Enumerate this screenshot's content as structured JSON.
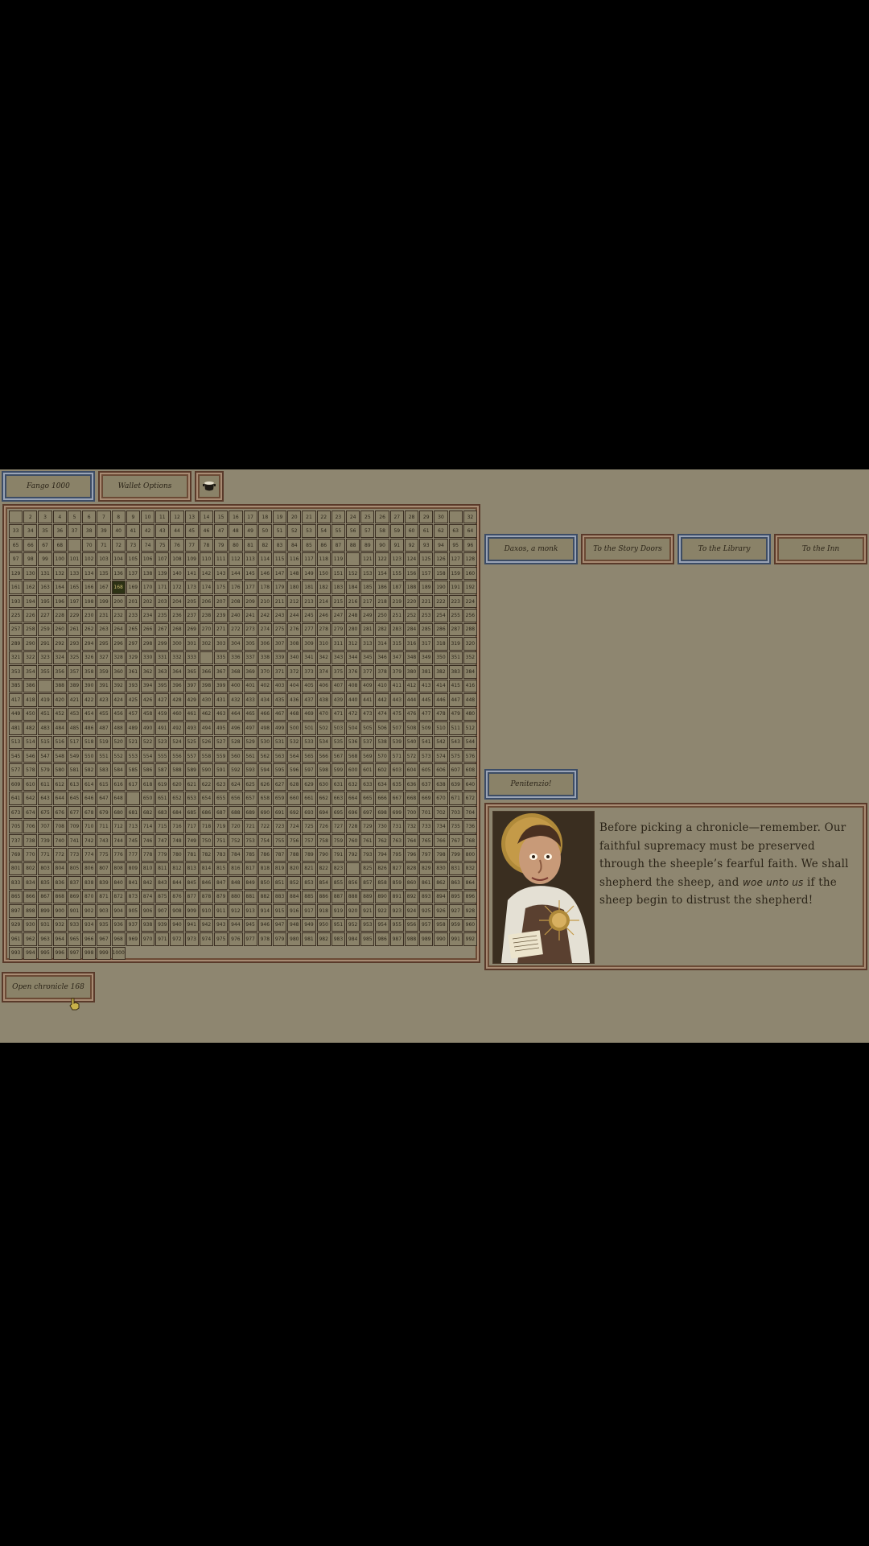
{
  "topbar": {
    "currency_label": "Fango 1000",
    "wallet_label": "Wallet Options",
    "pot_icon": "pot-icon"
  },
  "nav": {
    "buttons": [
      "Daxos, a monk",
      "To the Story Doors",
      "To the Library",
      "To the Inn"
    ],
    "penitenzio_label": "Penitenzio!"
  },
  "chronicle_grid": {
    "columns": 32,
    "rows": 32,
    "max": 1000,
    "selected": 168,
    "missing": [
      1,
      31,
      69,
      120,
      334,
      387,
      649,
      824
    ]
  },
  "dialog": {
    "text_before": "Before picking a chronicle—remember. Our faithful supremacy must be preserved through the sheeple’s fearful faith. We shall shepherd the sheep, and ",
    "text_emph": "woe unto us",
    "text_after": " if the sheep begin to distrust the shepherd!"
  },
  "open_button": {
    "label": "Open chronicle 168"
  },
  "colors": {
    "background": "#8e8670",
    "border_red": "#5a3a2a",
    "border_blue": "#3c4c66",
    "selected_cell": "#2c3114"
  }
}
